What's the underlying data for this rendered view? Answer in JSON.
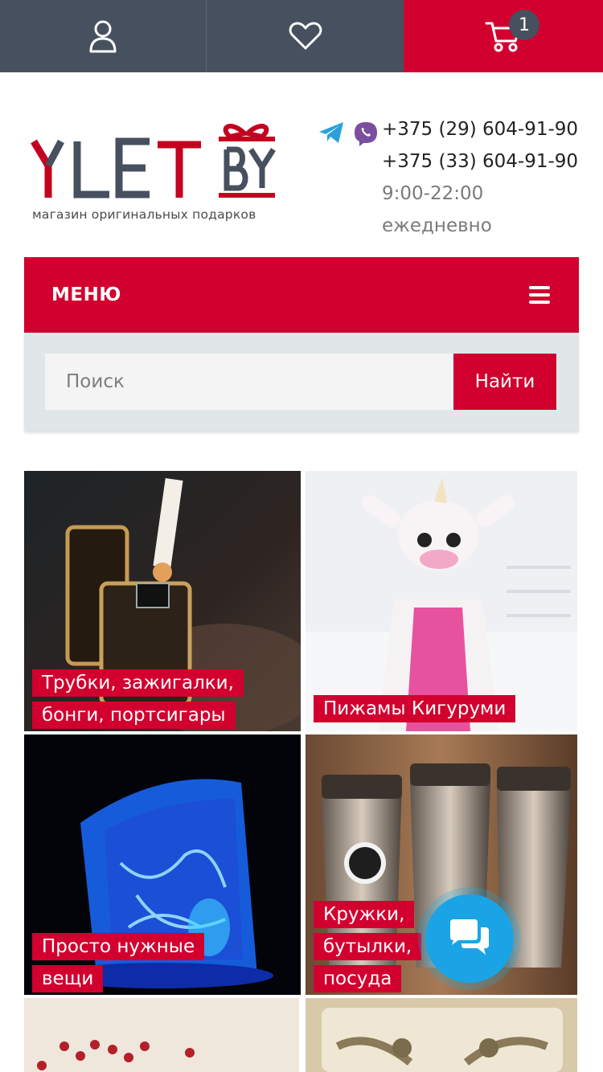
{
  "topbar": {
    "account_icon": "user-icon",
    "favorites_icon": "heart-icon",
    "cart_icon": "cart-icon",
    "cart_count": "1",
    "colors": {
      "bar": "#47505e",
      "cart": "#d1002e"
    }
  },
  "header": {
    "logo_tagline": "магазин оригинальных подарков",
    "messengers": [
      "telegram-icon",
      "viber-icon"
    ],
    "phone_1": "+375 (29) 604-91-90",
    "phone_2": "+375 (33) 604-91-90",
    "hours": "9:00-22:00",
    "days": "ежедневно"
  },
  "menu": {
    "label": "МЕНЮ",
    "icon": "hamburger-icon"
  },
  "search": {
    "placeholder": "Поиск",
    "button_label": "Найти"
  },
  "categories": [
    {
      "label": "Трубки, зажигалки, бонги, портсигары"
    },
    {
      "label": "Пижамы Кигуруми"
    },
    {
      "label": "Просто нужные вещи"
    },
    {
      "label": "Кружки, бутылки, посуда"
    },
    {
      "label": ""
    },
    {
      "label": ""
    }
  ],
  "chat": {
    "icon": "chat-icon"
  },
  "accent_color": "#d1002e"
}
